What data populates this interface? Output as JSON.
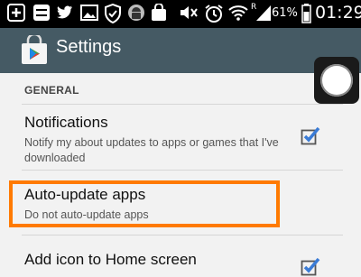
{
  "status_bar": {
    "battery_percent": "61%",
    "clock": "01:29",
    "network_badge": "R",
    "icons": [
      "add-icon",
      "equals-icon",
      "twitter-icon",
      "image-icon",
      "shield-icon",
      "android-icon",
      "bag-icon",
      "mute-icon",
      "alarm-icon",
      "wifi-icon",
      "signal-icon",
      "battery-icon"
    ]
  },
  "action_bar": {
    "title": "Settings",
    "app_icon": "play-store-icon"
  },
  "settings": {
    "section_header": "GENERAL",
    "items": [
      {
        "title": "Notifications",
        "summary": "Notify my about updates to apps or games that I've downloaded",
        "checked": true
      },
      {
        "title": "Auto-update apps",
        "summary": "Do not auto-update apps",
        "highlighted": true
      },
      {
        "title": "Add icon to Home screen",
        "checked": true
      }
    ]
  },
  "colors": {
    "action_bar": "#455a64",
    "checkbox": "#3a7bd5",
    "highlight": "#ff7a00",
    "background": "#f2f2f2"
  }
}
